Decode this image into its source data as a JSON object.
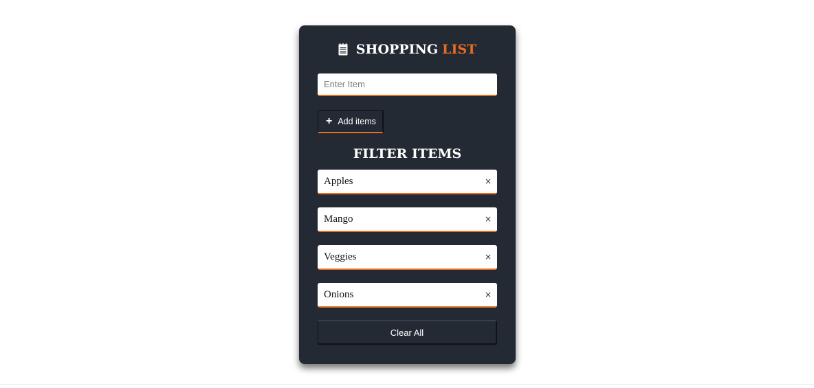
{
  "header": {
    "icon": "notepad-icon",
    "title_main": "SHOPPING",
    "title_accent": "LIST"
  },
  "form": {
    "item_placeholder": "Enter Item",
    "item_value": "",
    "add_icon": "plus-icon",
    "add_label": "Add items"
  },
  "filter": {
    "title": "FILTER ITEMS"
  },
  "items": [
    {
      "name": "Apples",
      "remove_glyph": "×"
    },
    {
      "name": "Mango",
      "remove_glyph": "×"
    },
    {
      "name": "Veggies",
      "remove_glyph": "×"
    },
    {
      "name": "Onions",
      "remove_glyph": "×"
    }
  ],
  "actions": {
    "clear_label": "Clear All"
  },
  "colors": {
    "card_background": "#242a33",
    "accent": "#e96d1f",
    "item_background": "#ffffff"
  }
}
